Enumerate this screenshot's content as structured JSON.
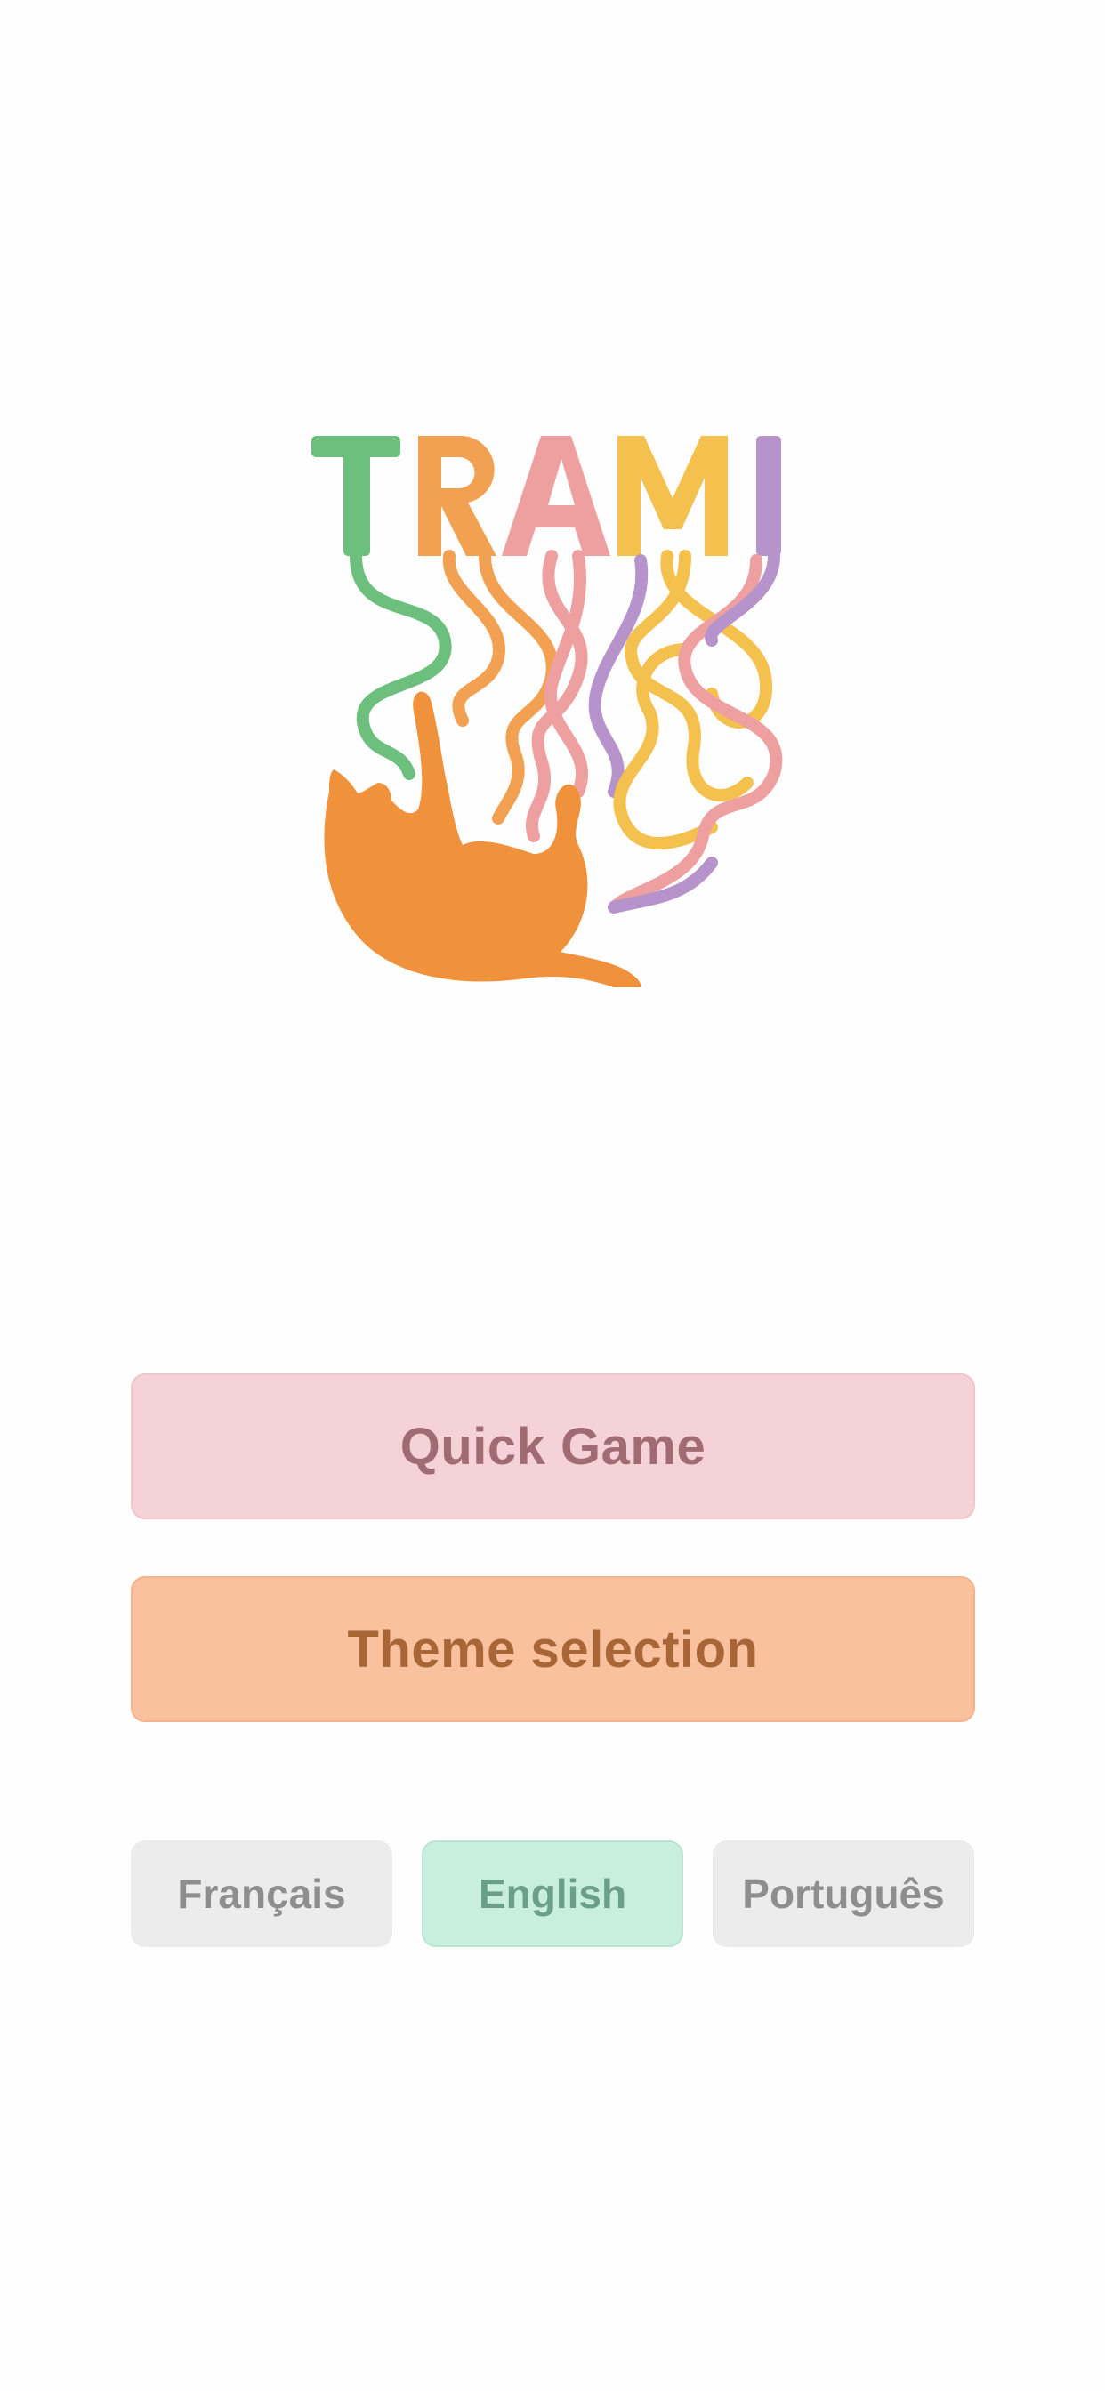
{
  "app": {
    "logo_text": "TRAMI",
    "logo_colors": {
      "T": "#6dbf7d",
      "R": "#f2a152",
      "A": "#eea0a0",
      "M": "#f4c04e",
      "I": "#b693cb",
      "cat": "#f0913c"
    }
  },
  "menu": {
    "quick_game_label": "Quick Game",
    "theme_selection_label": "Theme selection"
  },
  "languages": {
    "options": [
      "Français",
      "English",
      "Português"
    ],
    "selected": "English"
  },
  "colors": {
    "quick_game_bg": "#f5d2d7",
    "theme_selection_bg": "#f9c19d",
    "language_selected_bg": "#c7eedf",
    "language_bg": "#ececec"
  }
}
